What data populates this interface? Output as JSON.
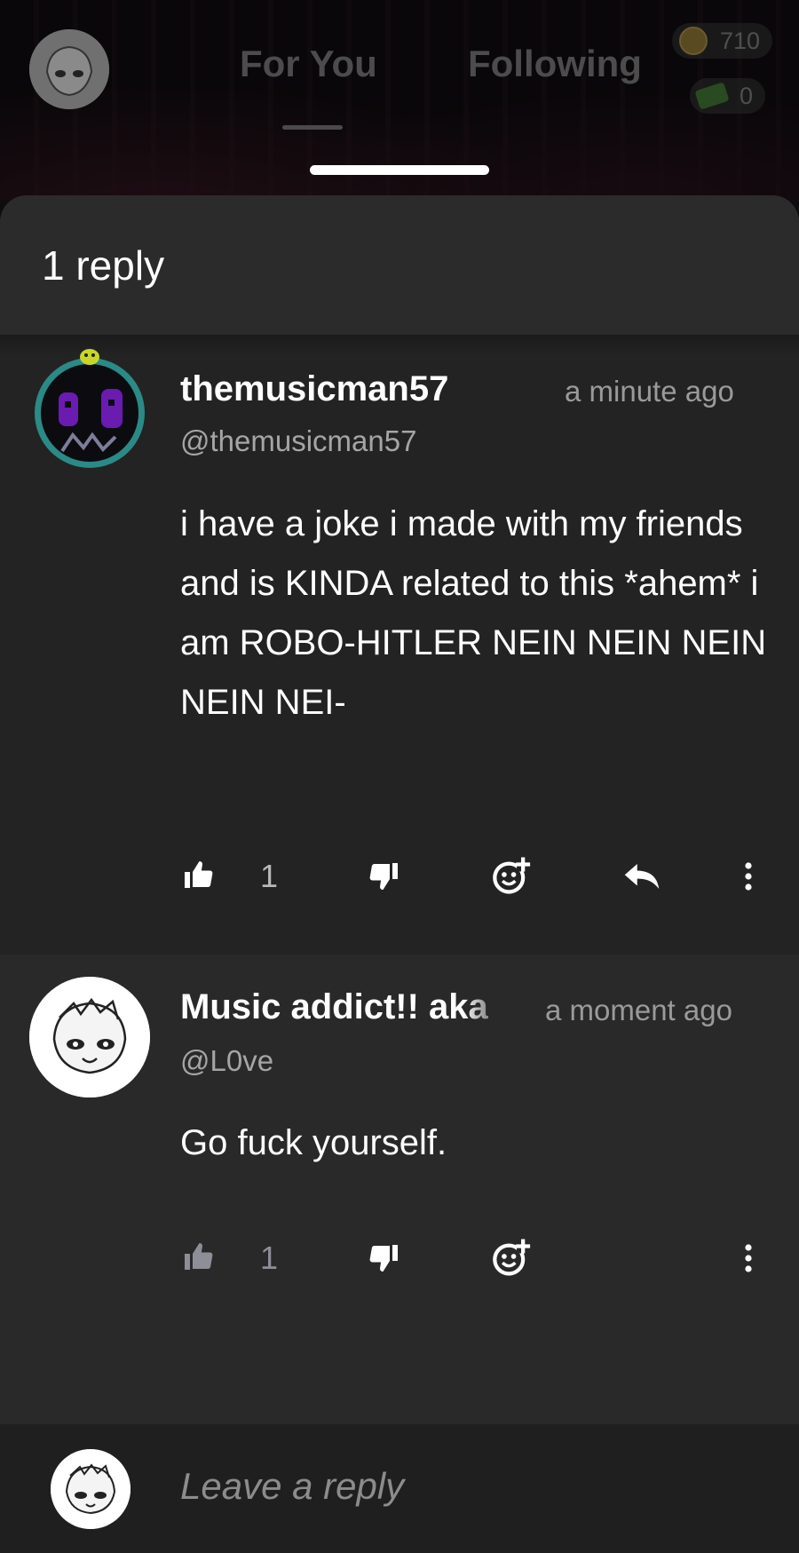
{
  "topbar": {
    "tabs": [
      {
        "label": "For You"
      },
      {
        "label": "Following"
      }
    ],
    "coins": "710",
    "cash": "0"
  },
  "sheet": {
    "reply_count_label": "1 reply"
  },
  "parent_comment": {
    "username": "themusicman57",
    "handle": "@themusicman57",
    "time": "a minute ago",
    "body": "i have a joke i made with my friends and is KINDA related to this *ahem* i am ROBO-HITLER NEIN NEIN NEIN NEIN NEI-",
    "like_count": "1",
    "icons": [
      "thumbs-up-icon",
      "thumbs-down-icon",
      "add-reaction-icon",
      "reply-arrow-icon",
      "more-vertical-icon"
    ]
  },
  "reply_comment": {
    "username": "Music addict!! aka",
    "handle": "@L0ve",
    "time": "a moment ago",
    "body": "Go fuck yourself.",
    "like_count": "1",
    "icons": [
      "thumbs-up-icon",
      "thumbs-down-icon",
      "add-reaction-icon",
      "more-vertical-icon"
    ]
  },
  "composer": {
    "placeholder": "Leave a reply"
  },
  "colors": {
    "sheet_bg": "#262626",
    "parent_bg": "#232323",
    "reply_bg": "#292929",
    "composer_bg": "#1f1f1f",
    "avatar_ring": "#2a8a86",
    "avatar_purple": "#6a1bb0"
  }
}
